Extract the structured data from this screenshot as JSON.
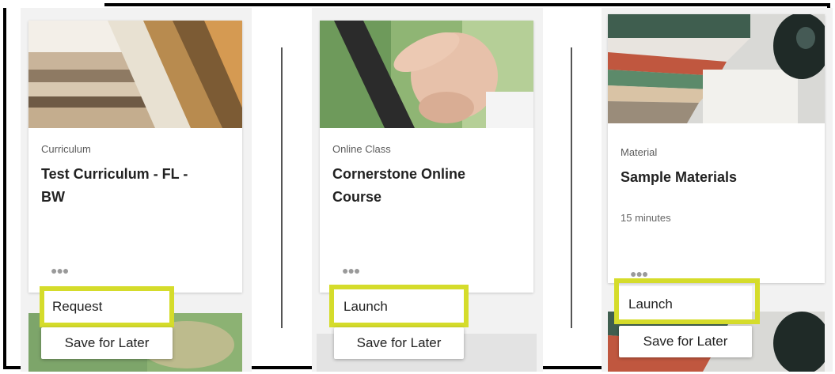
{
  "cards": [
    {
      "type": "Curriculum",
      "title_lines": [
        "Test Curriculum - FL -",
        "BW"
      ],
      "more_icon": "ellipsis-icon",
      "primary_action": "Request",
      "secondary_action": "Save for Later"
    },
    {
      "type": "Online Class",
      "title_lines": [
        "Cornerstone Online",
        "Course"
      ],
      "more_icon": "ellipsis-icon",
      "primary_action": "Launch",
      "secondary_action": "Save for Later"
    },
    {
      "type": "Material",
      "title_lines": [
        "Sample Materials"
      ],
      "duration": "15 minutes",
      "more_icon": "ellipsis-icon",
      "primary_action": "Launch",
      "secondary_action": "Save for Later"
    }
  ],
  "colors": {
    "highlight": "#d5dc2b",
    "card_bg": "#ffffff",
    "column_bg": "#f2f2f2",
    "frame": "#000000"
  }
}
